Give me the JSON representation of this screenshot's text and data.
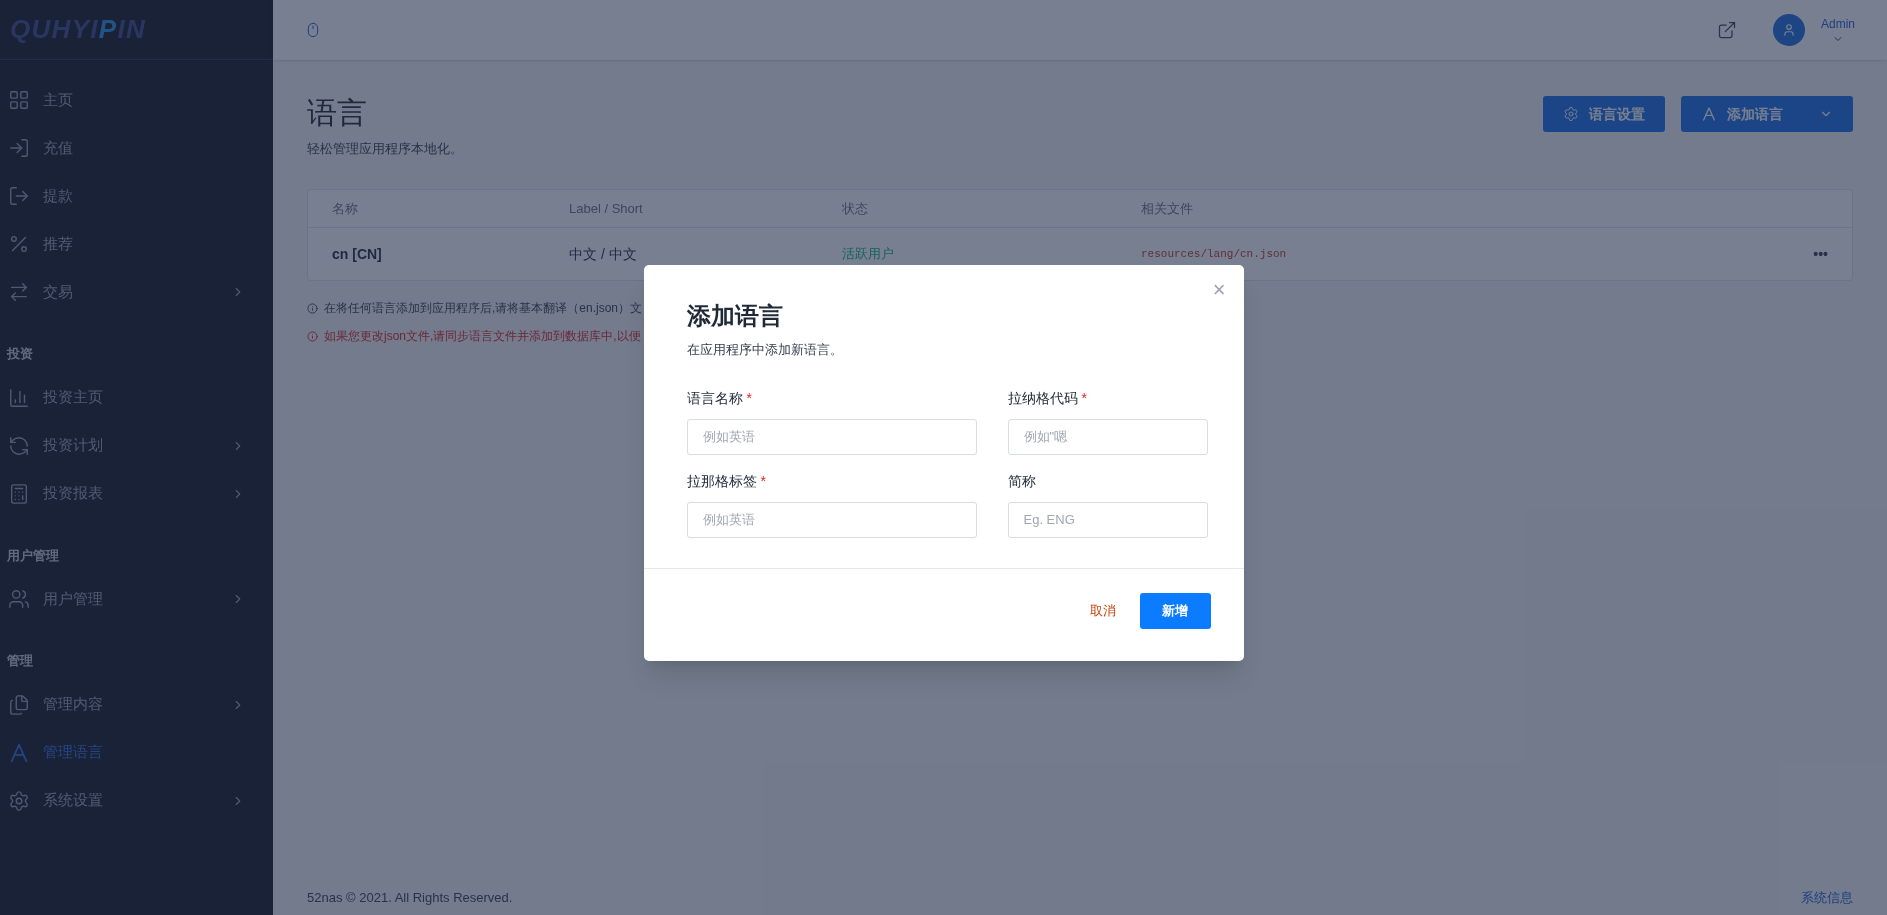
{
  "logo": {
    "parts": [
      {
        "text": "QUHYI",
        "highlight": false
      },
      {
        "text": "P",
        "highlight": true
      },
      {
        "text": "IN",
        "highlight": false
      }
    ]
  },
  "sidebar": {
    "sections": [
      {
        "items": [
          {
            "kind": "grid",
            "label": "主页",
            "has_children": false,
            "selected": false
          },
          {
            "kind": "deposit",
            "label": "充值",
            "has_children": false,
            "selected": false
          },
          {
            "kind": "withdraw",
            "label": "提款",
            "has_children": false,
            "selected": false
          },
          {
            "kind": "percent",
            "label": "推荐",
            "has_children": false,
            "selected": false
          },
          {
            "kind": "exchange",
            "label": "交易",
            "has_children": true,
            "selected": false
          }
        ]
      },
      {
        "title": "投资",
        "items": [
          {
            "kind": "chart",
            "label": "投资主页",
            "has_children": false,
            "selected": false
          },
          {
            "kind": "cycle",
            "label": "投资计划",
            "has_children": true,
            "selected": false
          },
          {
            "kind": "calc",
            "label": "投资报表",
            "has_children": true,
            "selected": false
          }
        ]
      },
      {
        "title": "用户管理",
        "items": [
          {
            "kind": "users",
            "label": "用户管理",
            "has_children": true,
            "selected": false
          }
        ]
      },
      {
        "title": "管理",
        "items": [
          {
            "kind": "files",
            "label": "管理内容",
            "has_children": true,
            "selected": false
          },
          {
            "kind": "letter",
            "label": "管理语言",
            "has_children": false,
            "selected": true
          },
          {
            "kind": "gear",
            "label": "系统设置",
            "has_children": true,
            "selected": false
          }
        ]
      }
    ]
  },
  "header": {
    "user": "Admin"
  },
  "page": {
    "title": "语言",
    "subtitle": "轻松管理应用程序本地化。",
    "buttons": [
      {
        "kind": "gear",
        "label": "语言设置",
        "dropdown": false
      },
      {
        "kind": "letter",
        "label": "添加语言",
        "dropdown": true
      }
    ]
  },
  "table": {
    "columns": [
      "名称",
      "Label / Short",
      "状态",
      "相关文件"
    ],
    "rows": [
      {
        "name": "cn [CN]",
        "label_short": "中文 / 中文",
        "status": "活跃用户",
        "file": "resources/lang/cn.json",
        "menu": "•••"
      }
    ]
  },
  "notes": [
    {
      "kind": "info",
      "text": "在将任何语言添加到应用程序后,请将基本翻译（en.json）文"
    },
    {
      "kind": "warning",
      "text": "如果您更改json文件,请同步语言文件并添加到数据库中,以便"
    }
  ],
  "modal": {
    "title": "添加语言",
    "subtitle": "在应用程序中添加新语言。",
    "close": "×",
    "fields": [
      {
        "label": "语言名称",
        "mark": "*",
        "placeholder": "例如英语",
        "wide": true
      },
      {
        "label": "拉纳格代码",
        "mark": "*",
        "placeholder": "例如\"嗯",
        "wide": false
      },
      {
        "label": "拉那格标签",
        "mark": "*",
        "placeholder": "例如英语",
        "wide": true
      },
      {
        "label": "简称",
        "placeholder": "Eg. ENG",
        "wide": false
      }
    ],
    "cancel": "取消",
    "submit": "新增"
  },
  "footer": {
    "copyright": "52nas © 2021. All Rights Reserved.",
    "link": "系统信息"
  }
}
